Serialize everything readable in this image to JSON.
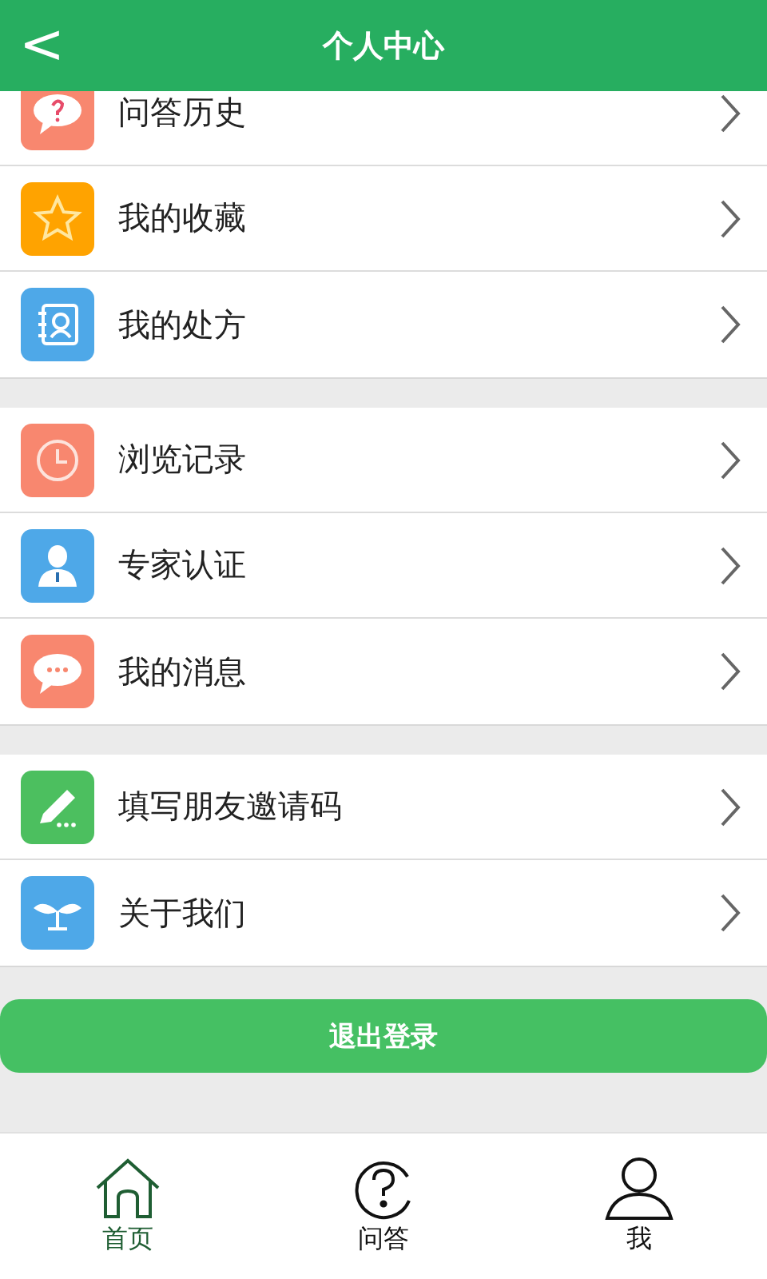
{
  "header": {
    "back": "<",
    "title": "个人中心"
  },
  "groups": [
    {
      "items": [
        {
          "label": "问答历史",
          "color": "#f8876f"
        },
        {
          "label": "我的收藏",
          "color": "#ffa300"
        },
        {
          "label": "我的处方",
          "color": "#4ea8e8"
        }
      ]
    },
    {
      "items": [
        {
          "label": "浏览记录",
          "color": "#f8876f"
        },
        {
          "label": "专家认证",
          "color": "#4ea8e8"
        },
        {
          "label": "我的消息",
          "color": "#f8876f"
        }
      ]
    },
    {
      "items": [
        {
          "label": "填写朋友邀请码",
          "color": "#4cbf5f"
        },
        {
          "label": "关于我们",
          "color": "#4ea8e8"
        }
      ]
    }
  ],
  "logout": "退出登录",
  "tabs": [
    {
      "label": "首页",
      "selected": true
    },
    {
      "label": "问答",
      "selected": false
    },
    {
      "label": "我",
      "selected": false
    }
  ]
}
